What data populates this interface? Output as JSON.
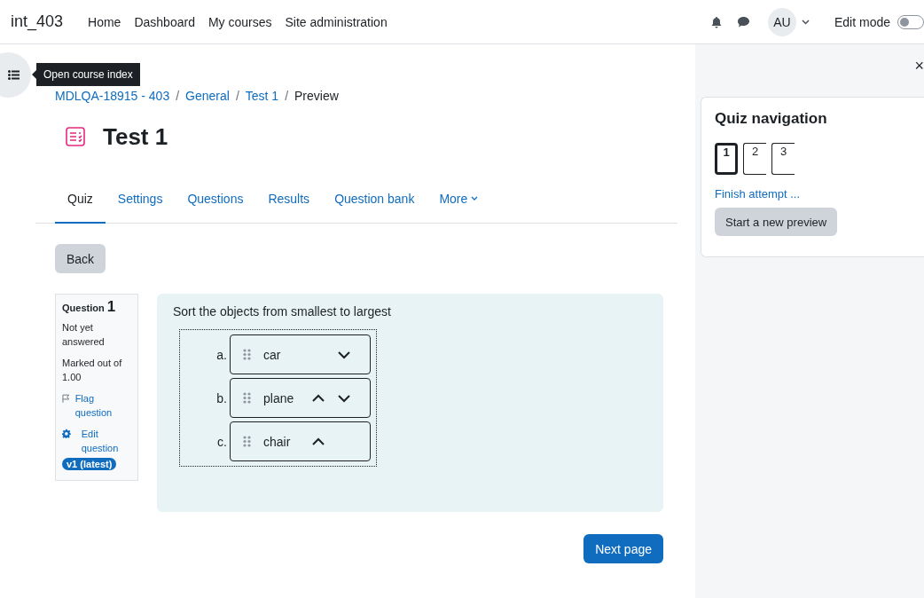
{
  "navbar": {
    "site_name": "int_403",
    "links": [
      "Home",
      "Dashboard",
      "My courses",
      "Site administration"
    ],
    "avatar": "AU",
    "edit_mode": {
      "label": "Edit mode",
      "on": false
    }
  },
  "course_index": {
    "tooltip": "Open course index"
  },
  "breadcrumb": {
    "links": [
      "MDLQA-18915 - 403",
      "General",
      "Test 1"
    ],
    "separators": [
      "/",
      "/",
      "/"
    ],
    "current": "Preview"
  },
  "title": "Test 1",
  "tabs": [
    {
      "label": "Quiz",
      "selected": true
    },
    {
      "label": "Settings",
      "selected": false
    },
    {
      "label": "Questions",
      "selected": false
    },
    {
      "label": "Results",
      "selected": false
    },
    {
      "label": "Question bank",
      "selected": false
    },
    {
      "label": "More",
      "selected": false
    }
  ],
  "back_button": "Back",
  "question_info": {
    "label": "Question",
    "number": "1",
    "state": "Not yet answered",
    "marks": "Marked out of 1.00",
    "flag": "Flag question",
    "edit": "Edit question",
    "version": "v1 (latest)"
  },
  "question": {
    "text": "Sort the objects from smallest to largest",
    "items": [
      {
        "marker": "a.",
        "text": "car",
        "can_move_up": false,
        "can_move_down": true
      },
      {
        "marker": "b.",
        "text": "plane",
        "can_move_up": true,
        "can_move_down": true
      },
      {
        "marker": "c.",
        "text": "chair",
        "can_move_up": true,
        "can_move_down": false
      }
    ]
  },
  "next_button": "Next page",
  "drawer": {
    "close": "×"
  },
  "quiz_navigation": {
    "title": "Quiz navigation",
    "buttons": [
      {
        "label": "1",
        "selected": true
      },
      {
        "label": "2",
        "selected": false
      },
      {
        "label": "3",
        "selected": false
      }
    ],
    "finish": "Finish attempt ...",
    "new_preview": "Start a new preview"
  }
}
